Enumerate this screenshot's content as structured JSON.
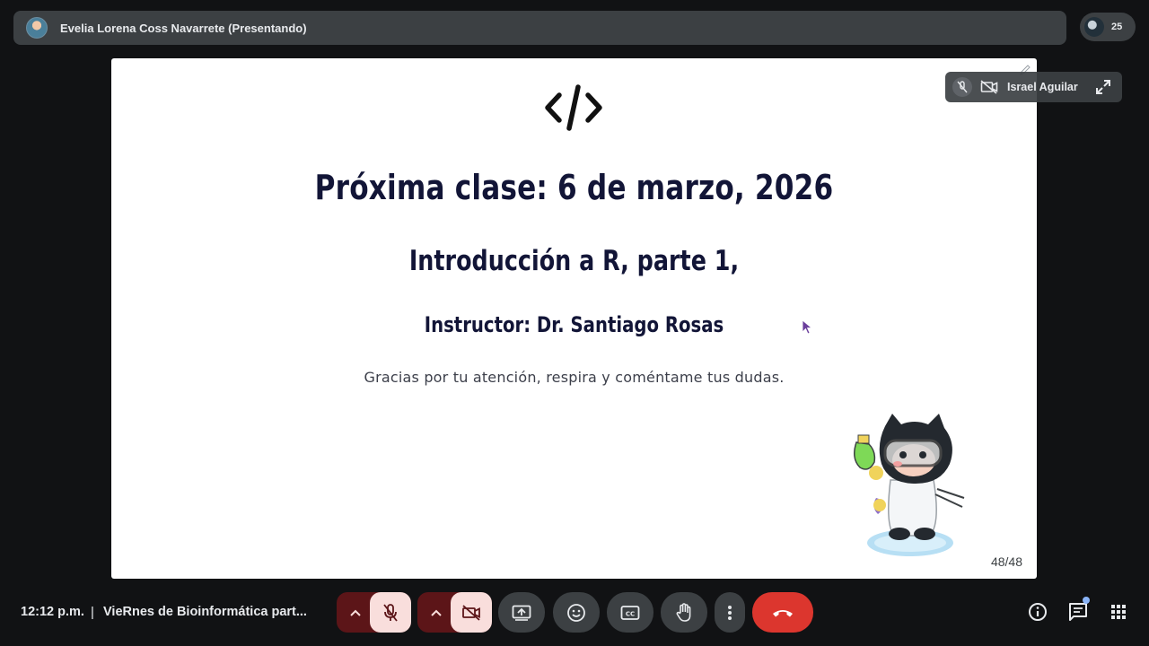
{
  "top_bar": {
    "presenter": "Evelia Lorena Coss Navarrete (Presentando)",
    "participant_count": "25"
  },
  "slide": {
    "title": "Próxima clase: 6 de marzo, 2026",
    "subtitle": "Introducción a R, parte 1,",
    "instructor": "Instructor: Dr. Santiago Rosas",
    "note": "Gracias por tu atención, respira y coméntame tus dudas.",
    "page": "48/48"
  },
  "self_tile": {
    "name": "Israel Aguilar"
  },
  "bottom_bar": {
    "time": "12:12 p.m.",
    "separator": "|",
    "meeting_title": "VieRnes de Bioinformática part..."
  },
  "colors": {
    "slide_title": "#121537",
    "end_call": "#dc362e",
    "muted_button_bg": "#f9dedc",
    "muted_group_bg": "#5c1518",
    "dark_button_bg": "#3c4043"
  },
  "icons": {
    "code": "code-icon",
    "mic_off": "mic-off-icon",
    "cam_off": "videocam-off-icon",
    "present": "present-screen-icon",
    "emoji": "emoji-icon",
    "captions": "captions-icon",
    "raise_hand": "raise-hand-icon",
    "more": "more-vert-icon",
    "end_call": "call-end-icon",
    "info": "info-icon",
    "chat": "chat-icon",
    "activities": "apps-grid-icon"
  }
}
